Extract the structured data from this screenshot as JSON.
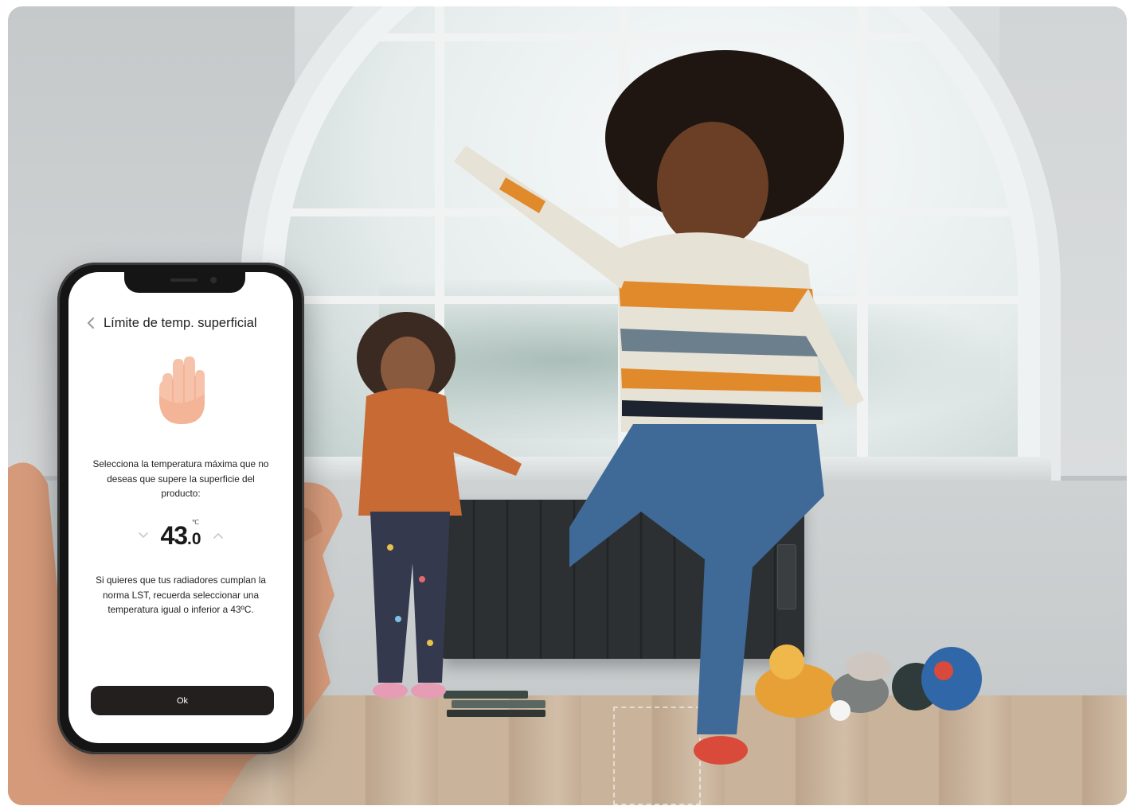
{
  "screen": {
    "title": "Límite de temp. superficial",
    "description": "Selecciona la temperatura máxima que no deseas que supere la superficie del producto:",
    "temperature": {
      "integer": "43",
      "decimal": ".0",
      "unit": "℃",
      "value": 43.0
    },
    "note": "Si quieres que tus radiadores cumplan la norma LST, recuerda seleccionar una temperatura igual o inferior a 43ºC.",
    "ok_label": "Ok"
  },
  "icons": {
    "back": "chevron-left-icon",
    "hand": "raised-hand-icon",
    "decrease": "chevron-down-icon",
    "increase": "chevron-up-icon"
  },
  "colors": {
    "button_bg": "#241f1f",
    "hand_icon": "#f1a98a",
    "radiator": "#2c3032"
  }
}
